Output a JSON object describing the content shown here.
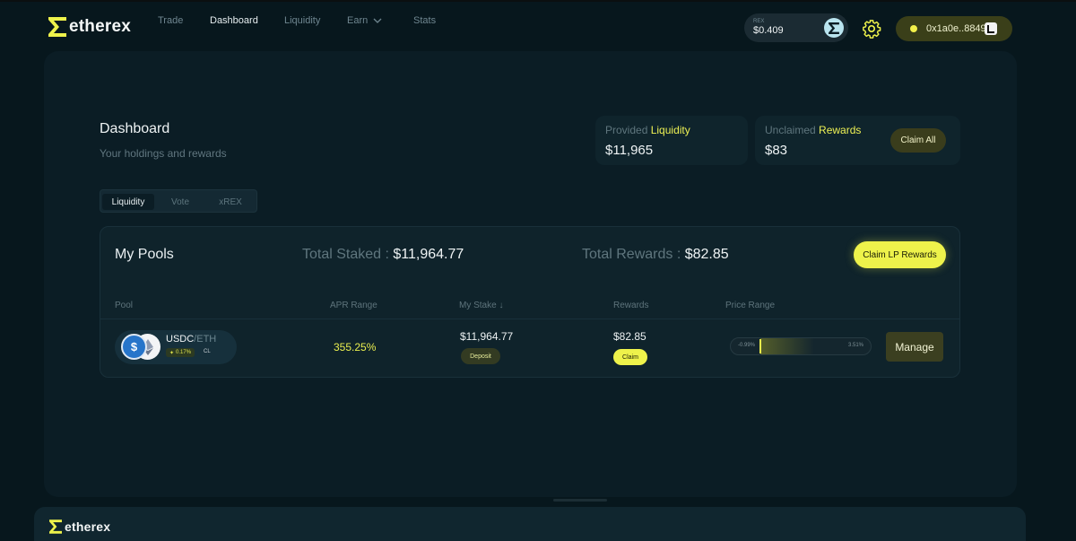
{
  "brand": {
    "name": "etherex"
  },
  "nav": {
    "trade": "Trade",
    "dashboard": "Dashboard",
    "liquidity": "Liquidity",
    "earn": "Earn",
    "stats": "Stats"
  },
  "token_price": {
    "label": "REX",
    "value": "$0.409"
  },
  "wallet": {
    "address": "0x1a0e..8849"
  },
  "dashboard": {
    "title": "Dashboard",
    "subtitle": "Your holdings and rewards"
  },
  "stats": {
    "provided_prefix": "Provided",
    "provided_highlight": "Liquidity",
    "provided_value": "$11,965",
    "unclaimed_prefix": "Unclaimed",
    "unclaimed_highlight": "Rewards",
    "unclaimed_value": "$83",
    "claim_all_label": "Claim All"
  },
  "tabs": [
    "Liquidity",
    "Vote",
    "xREX"
  ],
  "pools": {
    "title": "My Pools",
    "total_staked_label": "Total Staked :",
    "total_staked_value": "$11,964.77",
    "total_rewards_label": "Total Rewards :",
    "total_rewards_value": "$82.85",
    "claim_lp_label": "Claim LP Rewards",
    "columns": {
      "pool": "Pool",
      "apr": "APR Range",
      "stake": "My Stake",
      "rewards": "Rewards",
      "price": "Price Range"
    },
    "rows": [
      {
        "base": "USDC",
        "quote": "/ETH",
        "fee": "0.17%",
        "type": "CL",
        "apr": "355.25%",
        "stake": "$11,964.77",
        "deposit_label": "Deposit",
        "rewards": "$82.85",
        "claim_label": "Claim",
        "range_low": "-0.99%",
        "range_high": "3.51%",
        "manage_label": "Manage"
      }
    ]
  },
  "colors": {
    "accent": "#eef24b",
    "background": "#07171d",
    "panel": "#0b1d25"
  }
}
